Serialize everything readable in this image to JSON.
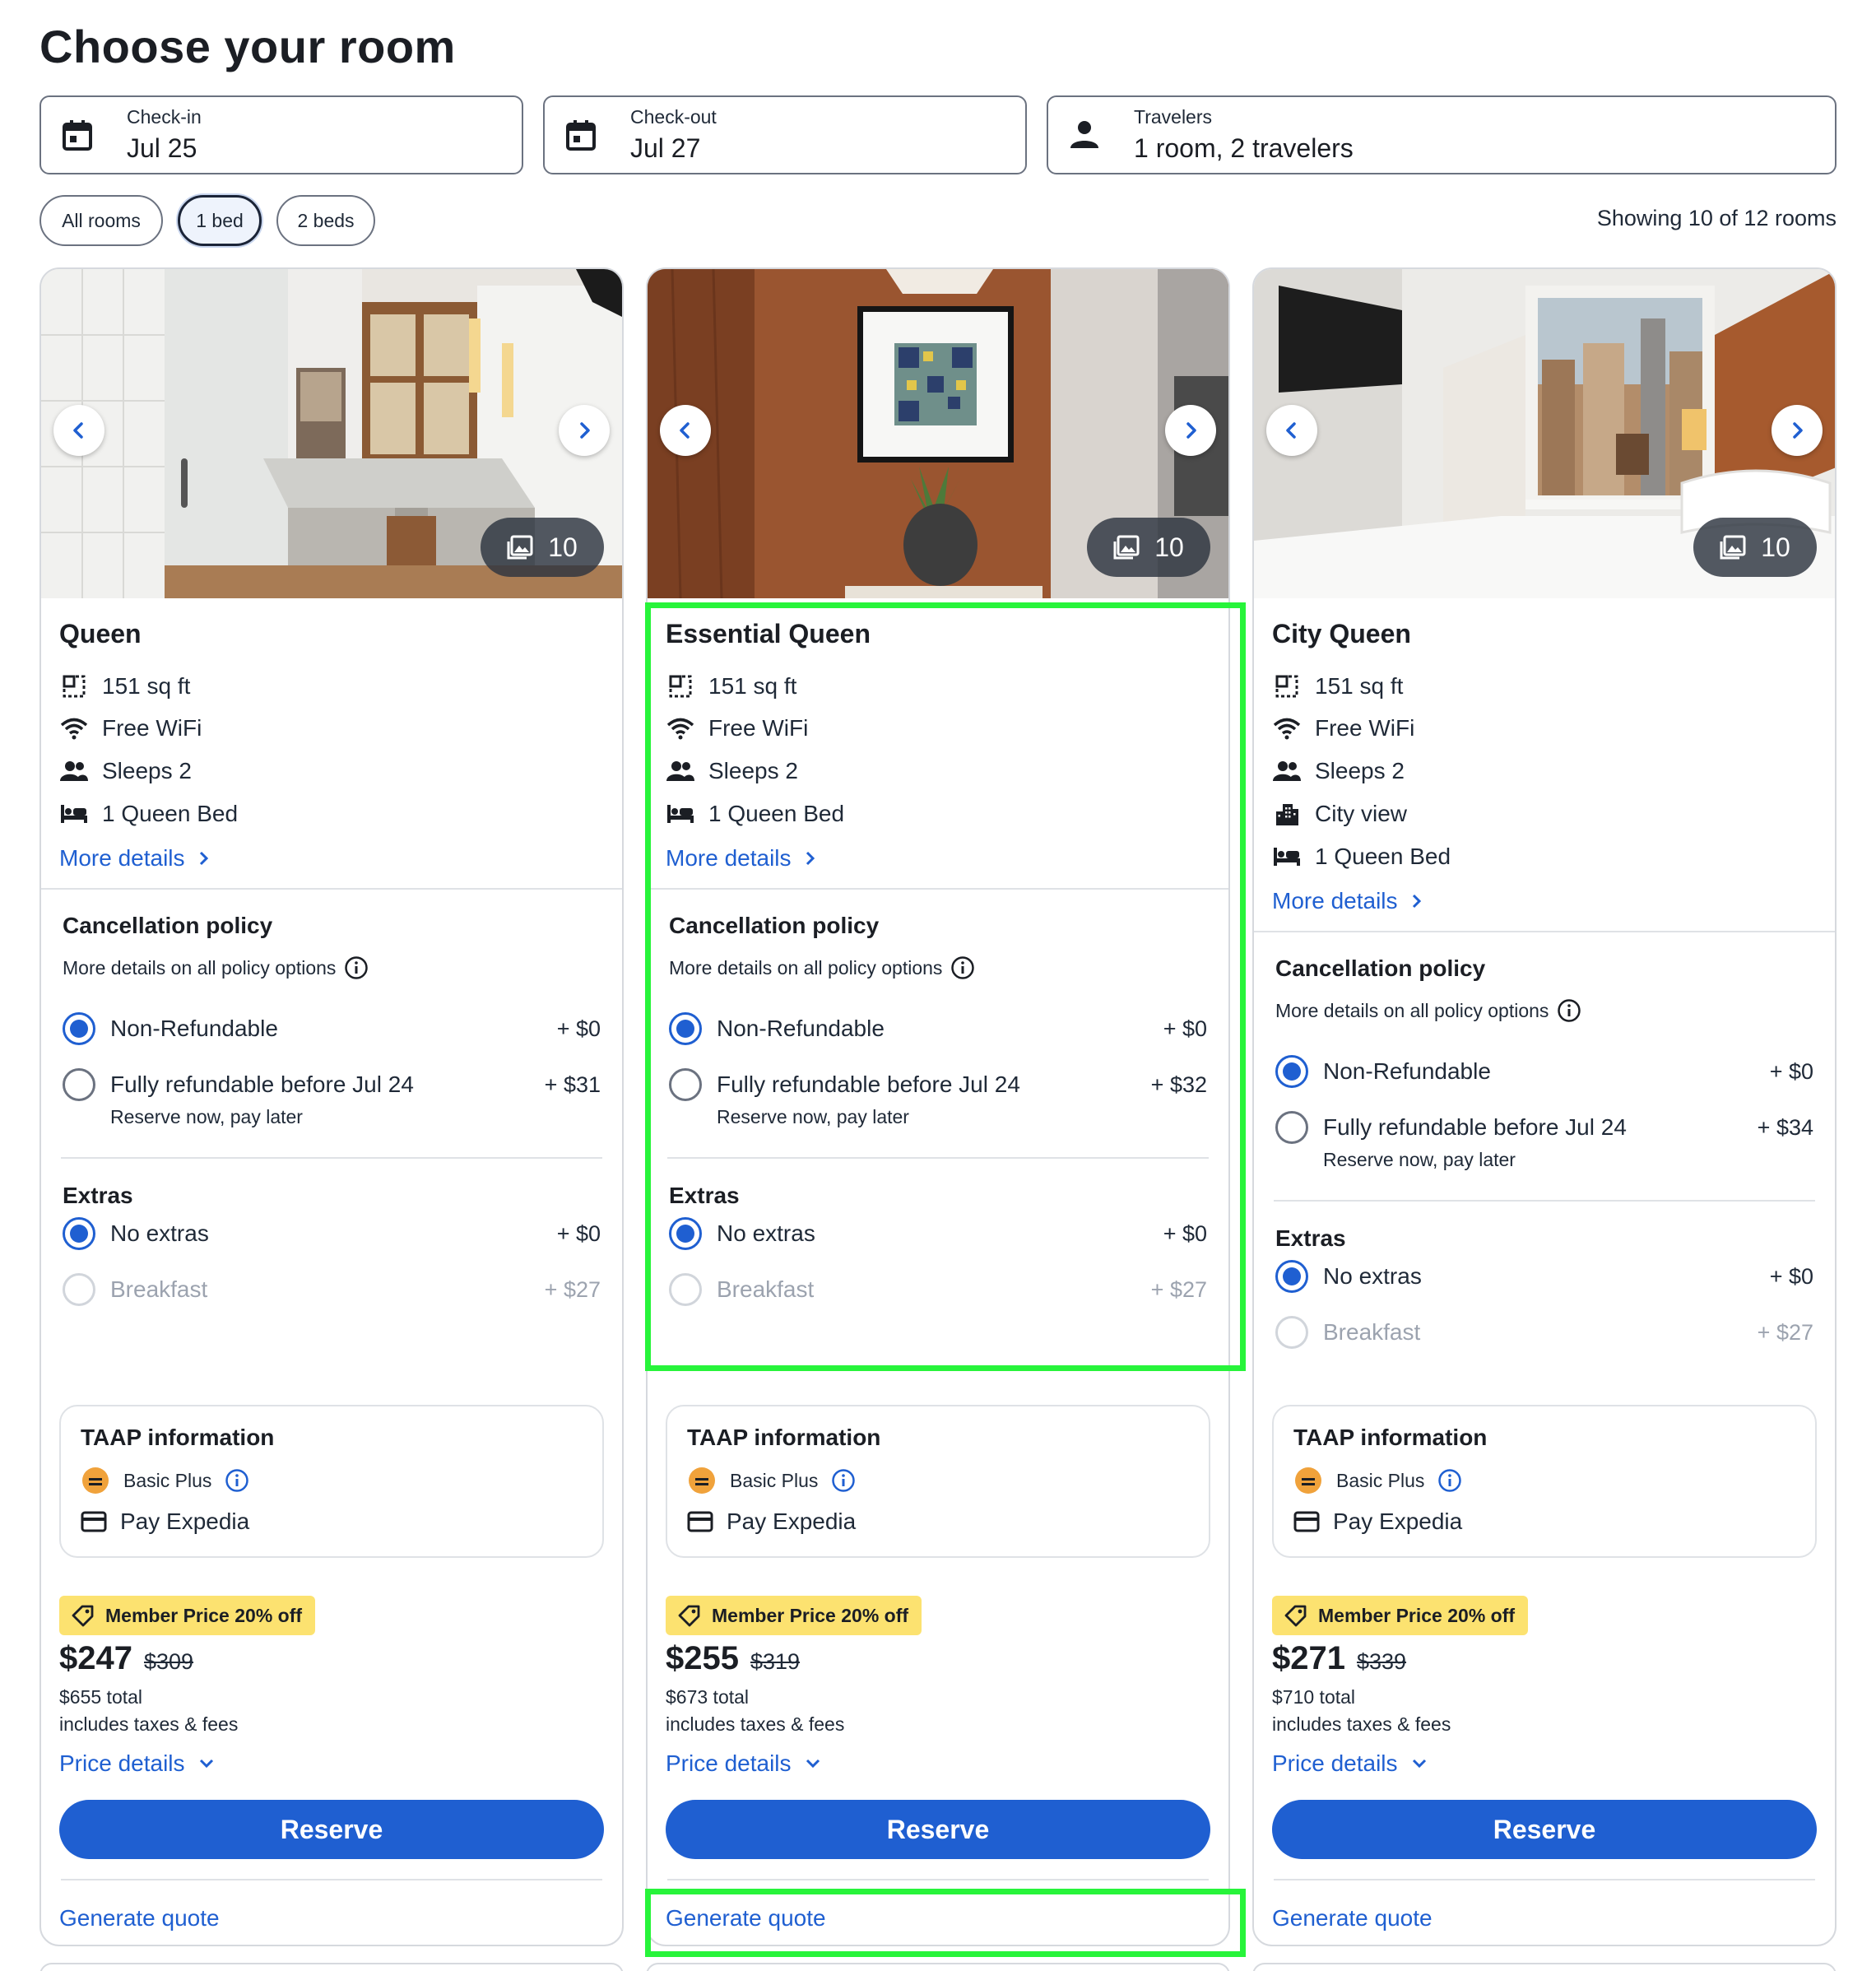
{
  "page": {
    "title": "Choose your room"
  },
  "search": {
    "checkin": {
      "label": "Check-in",
      "value": "Jul 25"
    },
    "checkout": {
      "label": "Check-out",
      "value": "Jul 27"
    },
    "travelers": {
      "label": "Travelers",
      "value": "1 room, 2 travelers"
    }
  },
  "filters": {
    "chips": [
      "All rooms",
      "1 bed",
      "2 beds"
    ],
    "active": "1 bed",
    "showing": "Showing 10 of 12 rooms"
  },
  "colors": {
    "accent": "#1f5fd1",
    "highlight": "#27f43a",
    "badge": "#fce270"
  },
  "cards": [
    {
      "name": "Queen",
      "photo_count": "10",
      "features": [
        {
          "icon": "square-footage-icon",
          "text": "151 sq ft"
        },
        {
          "icon": "wifi-icon",
          "text": "Free WiFi"
        },
        {
          "icon": "people-icon",
          "text": "Sleeps 2"
        },
        {
          "icon": "bed-icon",
          "text": "1 Queen Bed"
        }
      ],
      "more_details": "More details",
      "cancellation": {
        "title": "Cancellation policy",
        "subtitle": "More details on all policy options",
        "options": [
          {
            "label": "Non-Refundable",
            "price": "+ $0",
            "selected": true
          },
          {
            "label": "Fully refundable before Jul 24",
            "price": "+ $31",
            "note": "Reserve now, pay later",
            "selected": false
          }
        ]
      },
      "extras": {
        "title": "Extras",
        "options": [
          {
            "label": "No extras",
            "price": "+ $0",
            "selected": true
          },
          {
            "label": "Breakfast",
            "price": "+ $27",
            "disabled": true
          }
        ]
      },
      "taap": {
        "title": "TAAP information",
        "tier": "Basic Plus",
        "payment": "Pay Expedia"
      },
      "badge": "Member Price 20% off",
      "price": "$247",
      "old_price": "$309",
      "total": "$655 total",
      "taxes": "includes taxes & fees",
      "price_details": "Price details",
      "reserve": "Reserve",
      "quote": "Generate quote"
    },
    {
      "name": "Essential Queen",
      "photo_count": "10",
      "features": [
        {
          "icon": "square-footage-icon",
          "text": "151 sq ft"
        },
        {
          "icon": "wifi-icon",
          "text": "Free WiFi"
        },
        {
          "icon": "people-icon",
          "text": "Sleeps 2"
        },
        {
          "icon": "bed-icon",
          "text": "1 Queen Bed"
        }
      ],
      "more_details": "More details",
      "cancellation": {
        "title": "Cancellation policy",
        "subtitle": "More details on all policy options",
        "options": [
          {
            "label": "Non-Refundable",
            "price": "+ $0",
            "selected": true
          },
          {
            "label": "Fully refundable before Jul 24",
            "price": "+ $32",
            "note": "Reserve now, pay later",
            "selected": false
          }
        ]
      },
      "extras": {
        "title": "Extras",
        "options": [
          {
            "label": "No extras",
            "price": "+ $0",
            "selected": true
          },
          {
            "label": "Breakfast",
            "price": "+ $27",
            "disabled": true
          }
        ]
      },
      "taap": {
        "title": "TAAP information",
        "tier": "Basic Plus",
        "payment": "Pay Expedia"
      },
      "badge": "Member Price 20% off",
      "price": "$255",
      "old_price": "$319",
      "total": "$673 total",
      "taxes": "includes taxes & fees",
      "price_details": "Price details",
      "reserve": "Reserve",
      "quote": "Generate quote"
    },
    {
      "name": "City Queen",
      "photo_count": "10",
      "features": [
        {
          "icon": "square-footage-icon",
          "text": "151 sq ft"
        },
        {
          "icon": "wifi-icon",
          "text": "Free WiFi"
        },
        {
          "icon": "people-icon",
          "text": "Sleeps 2"
        },
        {
          "icon": "city-icon",
          "text": "City view"
        },
        {
          "icon": "bed-icon",
          "text": "1 Queen Bed"
        }
      ],
      "more_details": "More details",
      "cancellation": {
        "title": "Cancellation policy",
        "subtitle": "More details on all policy options",
        "options": [
          {
            "label": "Non-Refundable",
            "price": "+ $0",
            "selected": true
          },
          {
            "label": "Fully refundable before Jul 24",
            "price": "+ $34",
            "note": "Reserve now, pay later",
            "selected": false
          }
        ]
      },
      "extras": {
        "title": "Extras",
        "options": [
          {
            "label": "No extras",
            "price": "+ $0",
            "selected": true
          },
          {
            "label": "Breakfast",
            "price": "+ $27",
            "disabled": true
          }
        ]
      },
      "taap": {
        "title": "TAAP information",
        "tier": "Basic Plus",
        "payment": "Pay Expedia"
      },
      "badge": "Member Price 20% off",
      "price": "$271",
      "old_price": "$339",
      "total": "$710 total",
      "taxes": "includes taxes & fees",
      "price_details": "Price details",
      "reserve": "Reserve",
      "quote": "Generate quote"
    }
  ]
}
